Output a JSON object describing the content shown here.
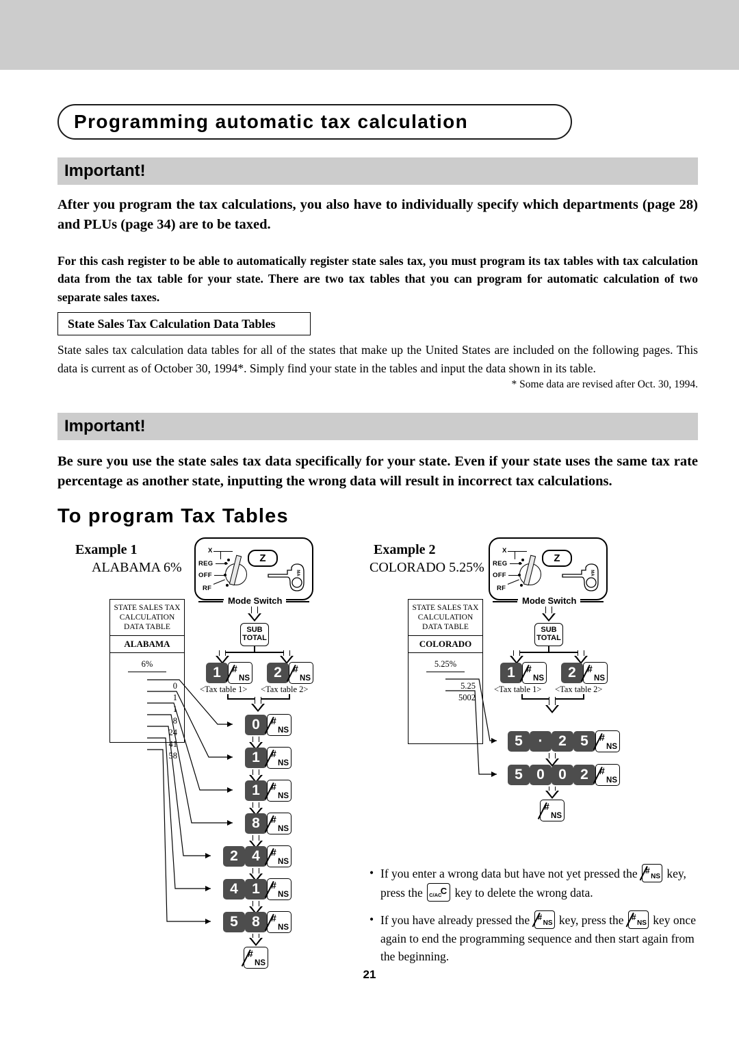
{
  "page": {
    "number": "21",
    "title": "Programming automatic tax calculation"
  },
  "important_1": {
    "heading": "Important!",
    "body": "After you program the tax calculations, you also have to individually specify which departments (page 28) and PLUs (page 34) are to be taxed."
  },
  "intro": {
    "paragraph": "For this cash register to be able to automatically register state sales tax, you must program its tax tables with tax calculation data from the tax table for your state.  There are two tax tables that you can program for automatic calculation of two separate sales taxes.",
    "subhead": "State Sales Tax Calculation Data Tables",
    "paragraph2": "State sales tax calculation data tables for all of the states that make up the United States are included on the following pages.  This data is current as of October 30, 1994*.    Simply find your state in the tables and input the data shown in its table.",
    "footnote": "* Some data are revised after Oct. 30, 1994."
  },
  "important_2": {
    "heading": "Important!",
    "body": "Be sure you use the state sales tax data specifically for your state.  Even if your state uses the same tax rate percentage as another state, inputting the wrong data will result in incorrect tax calculations."
  },
  "section": {
    "heading": "To program Tax Tables"
  },
  "mode_switch": {
    "label": "Mode Switch",
    "positions": [
      "X",
      "REG",
      "OFF",
      "RF"
    ],
    "selected": "Z",
    "key_text": "MA"
  },
  "keys": {
    "subtotal_line1": "SUB",
    "subtotal_line2": "TOTAL",
    "hash_symbol": "#",
    "ns_symbol": "NS",
    "cac_small": "C/AC",
    "cac_big": "C",
    "decimal": "·"
  },
  "example1": {
    "label": "Example  1",
    "state_rate": "ALABAMA 6%",
    "table": {
      "header_line1": "STATE SALES TAX",
      "header_line2": "CALCULATION",
      "header_line3": "DATA TABLE",
      "state": "ALABAMA",
      "rate": "6%",
      "values": [
        "0",
        "1",
        "1",
        "8",
        "24",
        "41",
        "58"
      ]
    },
    "tax_table_1_caption": "<Tax table 1>",
    "tax_table_2_caption": "<Tax table 2>",
    "tax_table_1_key": "1",
    "tax_table_2_key": "2",
    "sequence": [
      {
        "digits": [
          "0"
        ]
      },
      {
        "digits": [
          "1"
        ]
      },
      {
        "digits": [
          "1"
        ]
      },
      {
        "digits": [
          "8"
        ]
      },
      {
        "digits": [
          "2",
          "4"
        ]
      },
      {
        "digits": [
          "4",
          "1"
        ]
      },
      {
        "digits": [
          "5",
          "8"
        ]
      }
    ]
  },
  "example2": {
    "label": "Example  2",
    "state_rate": "COLORADO 5.25%",
    "table": {
      "header_line1": "STATE SALES TAX",
      "header_line2": "CALCULATION",
      "header_line3": "DATA TABLE",
      "state": "COLORADO",
      "rate": "5.25%",
      "values": [
        "5.25",
        "5002"
      ]
    },
    "tax_table_1_caption": "<Tax table 1>",
    "tax_table_2_caption": "<Tax table 2>",
    "tax_table_1_key": "1",
    "tax_table_2_key": "2",
    "sequence": [
      {
        "digits": [
          "5",
          "·",
          "2",
          "5"
        ]
      },
      {
        "digits": [
          "5",
          "0",
          "0",
          "2"
        ]
      }
    ]
  },
  "notes": [
    {
      "part1": "If you enter a wrong data but have not yet pressed the",
      "part2": "key, press the",
      "part3": "key to delete the wrong data."
    },
    {
      "part1": "If you have already pressed the",
      "part2": "key, press the",
      "part3": "key once again to end the programming sequence and then start again from the beginning."
    }
  ],
  "colors": {
    "band_gray": "#cccccc",
    "key_dark": "#4d4d4d",
    "ink": "#000000"
  }
}
